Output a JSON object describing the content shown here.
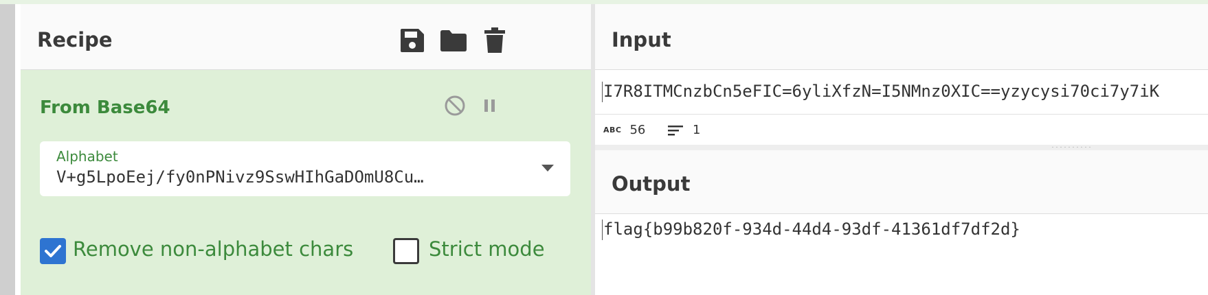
{
  "recipe": {
    "title": "Recipe",
    "toolbar": [
      {
        "icon": "save-icon"
      },
      {
        "icon": "folder-icon"
      },
      {
        "icon": "trash-icon"
      }
    ],
    "operation": {
      "name": "From Base64",
      "disable_icon": "disable-icon",
      "pause_icon": "pause-icon",
      "alphabet": {
        "label": "Alphabet",
        "value": "V+g5LpoEej/fy0nPNivz9SswHIhGaDOmU8Cu…"
      },
      "options": [
        {
          "label": "Remove non-alphabet chars",
          "checked": true
        },
        {
          "label": "Strict mode",
          "checked": false
        }
      ]
    }
  },
  "input": {
    "title": "Input",
    "text": "I7R8ITMCnzbCn5eFIC=6yliXfzN=I5NMnz0XIC==yzycysi70ci7y7iK",
    "status": {
      "length_icon": "abc-icon",
      "length": "56",
      "lines_icon": "lines-icon",
      "lines": "1"
    }
  },
  "output": {
    "title": "Output",
    "text": "flag{b99b820f-934d-44d4-93df-41361df7df2d}"
  },
  "colors": {
    "operation_bg": "#dff0d8",
    "operation_text": "#3c8a3c",
    "checkbox_checked": "#2e74d1"
  }
}
